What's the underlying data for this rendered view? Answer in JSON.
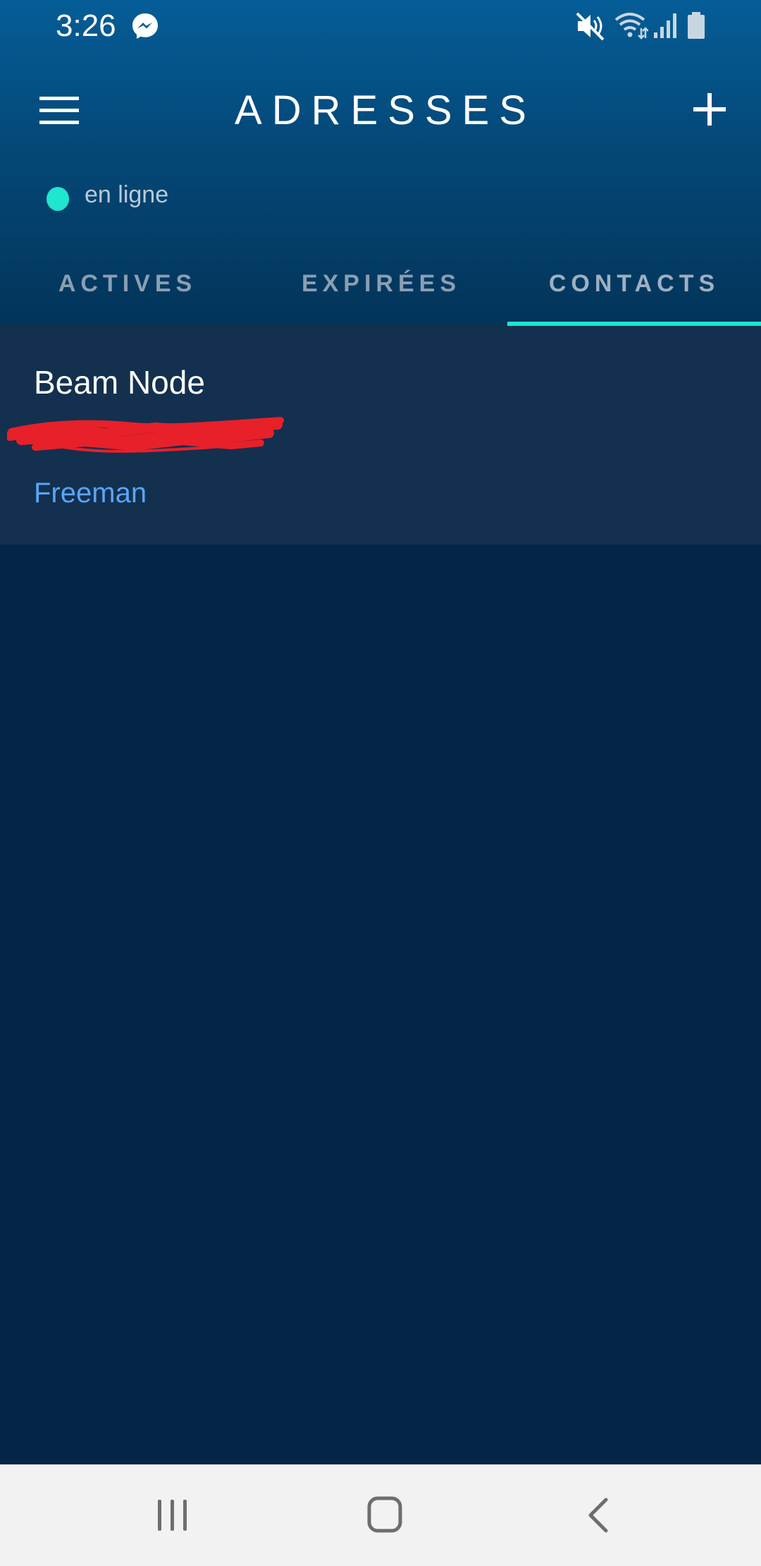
{
  "status_bar": {
    "time": "3:26",
    "icons": [
      "messenger-icon",
      "mute-icon",
      "wifi-icon",
      "signal-icon",
      "battery-icon"
    ]
  },
  "app_bar": {
    "title": "ADRESSES",
    "menu_icon": "menu-icon",
    "add_icon": "add-icon"
  },
  "connection": {
    "label": "en ligne",
    "dot_color": "#1ee6cf"
  },
  "tabs": [
    {
      "label": "ACTIVES",
      "active": false
    },
    {
      "label": "EXPIRÉES",
      "active": false
    },
    {
      "label": "CONTACTS",
      "active": true
    }
  ],
  "contacts": [
    {
      "name": "Beam Node",
      "address": "",
      "category": "Freeman"
    }
  ],
  "nav_bar": {
    "icons": [
      "recents-icon",
      "home-icon",
      "back-icon"
    ]
  },
  "colors": {
    "accent": "#1ee6cf",
    "background": "#042548",
    "card": "#13304f",
    "category": "#57a6f7",
    "redaction": "#e8202a"
  }
}
